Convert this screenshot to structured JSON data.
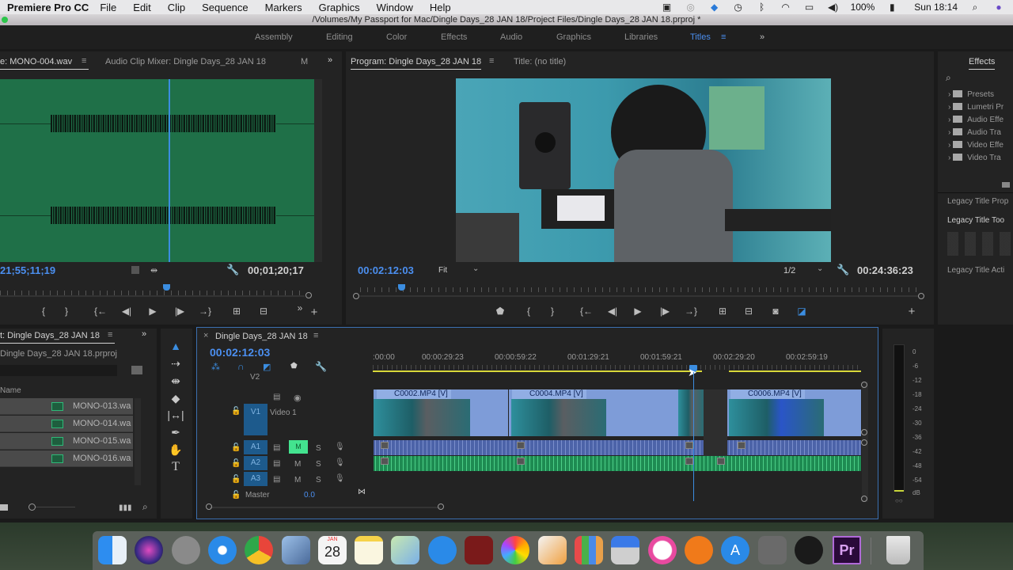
{
  "menubar": {
    "app_name": "Premiere Pro CC",
    "menus": [
      "File",
      "Edit",
      "Clip",
      "Sequence",
      "Markers",
      "Graphics",
      "Window",
      "Help"
    ],
    "status_icons": [
      "screen-record-icon",
      "creative-cloud-icon",
      "ua-connect-icon",
      "time-machine-icon",
      "bluetooth-icon",
      "wifi-icon",
      "airplay-icon",
      "volume-icon"
    ],
    "battery": "100%",
    "clock": "Sun 18:14"
  },
  "window": {
    "title": "/Volumes/My Passport for Mac/Dingle Days_28 JAN 18/Project Files/Dingle Days_28 JAN 18.prproj *"
  },
  "workspaces": {
    "tabs": [
      "Assembly",
      "Editing",
      "Color",
      "Effects",
      "Audio",
      "Graphics",
      "Libraries",
      "Titles"
    ],
    "active": "Titles",
    "overflow": "»"
  },
  "source_monitor": {
    "tab_label": "e: MONO-004.wav",
    "tab2_label": "Audio Clip Mixer: Dingle Days_28 JAN 18",
    "tab3_label": "M",
    "overflow": "»",
    "timecode_current": "21;55;11;19",
    "timecode_duration": "00;01;20;17",
    "playhead_fraction": 0.53,
    "controls": [
      "mark-in",
      "mark-out",
      "go-to-in",
      "step-back",
      "play",
      "step-forward",
      "go-to-out",
      "insert",
      "overwrite"
    ]
  },
  "program_monitor": {
    "tab_label": "Program: Dingle Days_28 JAN 18",
    "tab2_label": "Title: (no title)",
    "timecode_current": "00:02:12:03",
    "zoom": "Fit",
    "resolution": "1/2",
    "timecode_duration": "00:24:36:23",
    "playhead_fraction": 0.08,
    "controls": [
      "add-marker",
      "mark-in",
      "mark-out",
      "go-to-in",
      "step-back",
      "play",
      "step-forward",
      "go-to-out",
      "lift",
      "extract",
      "export-frame",
      "compare-view"
    ]
  },
  "effects_panel": {
    "tab_label": "Effects",
    "items": [
      "Presets",
      "Lumetri Presets",
      "Audio Effects",
      "Audio Transitions",
      "Video Effects",
      "Video Transitions"
    ],
    "items_visible": [
      "Presets",
      "Lumetri Pr",
      "Audio Effe",
      "Audio Tra",
      "Video Effe",
      "Video Tra"
    ],
    "sections": [
      "Legacy Title Prop",
      "Legacy Title Too",
      "Legacy Title Acti"
    ]
  },
  "project_panel": {
    "tab_label": "t: Dingle Days_28 JAN 18",
    "file": "Dingle Days_28 JAN 18.prproj",
    "column_name": "Name",
    "items": [
      "MONO-013.wa",
      "MONO-014.wa",
      "MONO-015.wa",
      "MONO-016.wa"
    ]
  },
  "tools": [
    "selection-tool",
    "track-select-tool",
    "ripple-edit-tool",
    "razor-tool",
    "slip-tool",
    "pen-tool",
    "hand-tool",
    "type-tool"
  ],
  "timeline": {
    "tab_label": "Dingle Days_28 JAN 18",
    "timecode": "00:02:12:03",
    "ruler": ":00:00|00:00:29:23|00:00:59:22|00:01:29:21|00:01:59:21|00:02:29:20|00:02:59:19",
    "ruler_ticks": [
      ":00:00",
      "00:00:29:23",
      "00:00:59:22",
      "00:01:29:21",
      "00:01:59:21",
      "00:02:29:20",
      "00:02:59:19"
    ],
    "tracks": {
      "v2": "V2",
      "v1": "V1",
      "v1_name": "Video 1",
      "a1": "A1",
      "a2": "A2",
      "a3": "A3",
      "master": "Master",
      "master_value": "0.0",
      "mute": "M",
      "solo": "S"
    },
    "clips": [
      "C0002.MP4 [V]",
      "C0004.MP4 [V]",
      "C0006.MP4 [V]"
    ]
  },
  "audio_meter": {
    "scale": [
      "0",
      "-6",
      "-12",
      "-18",
      "-24",
      "-30",
      "-36",
      "-42",
      "-48",
      "-54",
      "dB"
    ],
    "solo_buttons": "S S"
  },
  "dock": {
    "apps": [
      "Finder",
      "Siri",
      "Launchpad",
      "Safari",
      "Chrome",
      "Mail",
      "Calendar",
      "Notes",
      "Maps",
      "Messages",
      "Photo Booth",
      "Photos",
      "Pages",
      "Numbers",
      "Keynote",
      "iTunes",
      "iBooks",
      "App Store",
      "System Preferences",
      "UA Connect",
      "Premiere Pro",
      "Trash"
    ],
    "calendar_day": "28",
    "calendar_month": "JAN",
    "premiere_label": "Pr"
  }
}
